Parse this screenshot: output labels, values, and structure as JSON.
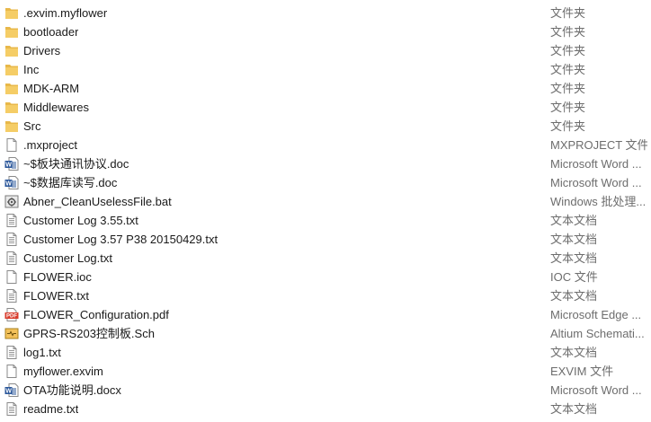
{
  "files": [
    {
      "name": ".exvim.myflower",
      "type": "文件夹",
      "icon": "folder-icon"
    },
    {
      "name": "bootloader",
      "type": "文件夹",
      "icon": "folder-icon"
    },
    {
      "name": "Drivers",
      "type": "文件夹",
      "icon": "folder-icon"
    },
    {
      "name": "Inc",
      "type": "文件夹",
      "icon": "folder-icon"
    },
    {
      "name": "MDK-ARM",
      "type": "文件夹",
      "icon": "folder-icon"
    },
    {
      "name": "Middlewares",
      "type": "文件夹",
      "icon": "folder-icon"
    },
    {
      "name": "Src",
      "type": "文件夹",
      "icon": "folder-icon"
    },
    {
      "name": ".mxproject",
      "type": "MXPROJECT 文件",
      "icon": "blank-file-icon"
    },
    {
      "name": "~$板块通讯协议.doc",
      "type": "Microsoft Word ...",
      "icon": "word-doc-icon"
    },
    {
      "name": "~$数据库读写.doc",
      "type": "Microsoft Word ...",
      "icon": "word-doc-icon"
    },
    {
      "name": "Abner_CleanUselessFile.bat",
      "type": "Windows 批处理...",
      "icon": "batch-file-icon"
    },
    {
      "name": "Customer Log 3.55.txt",
      "type": "文本文档",
      "icon": "text-file-icon"
    },
    {
      "name": "Customer Log 3.57 P38 20150429.txt",
      "type": "文本文档",
      "icon": "text-file-icon"
    },
    {
      "name": "Customer Log.txt",
      "type": "文本文档",
      "icon": "text-file-icon"
    },
    {
      "name": "FLOWER.ioc",
      "type": "IOC 文件",
      "icon": "blank-file-icon"
    },
    {
      "name": "FLOWER.txt",
      "type": "文本文档",
      "icon": "text-file-icon"
    },
    {
      "name": "FLOWER_Configuration.pdf",
      "type": "Microsoft Edge ...",
      "icon": "pdf-file-icon"
    },
    {
      "name": "GPRS-RS203控制板.Sch",
      "type": "Altium Schemati...",
      "icon": "schematic-file-icon"
    },
    {
      "name": "log1.txt",
      "type": "文本文档",
      "icon": "text-file-icon"
    },
    {
      "name": "myflower.exvim",
      "type": "EXVIM 文件",
      "icon": "blank-file-icon"
    },
    {
      "name": "OTA功能说明.docx",
      "type": "Microsoft Word ...",
      "icon": "word-doc-icon"
    },
    {
      "name": "readme.txt",
      "type": "文本文档",
      "icon": "text-file-icon"
    }
  ],
  "colors": {
    "folder": "#e8b84a",
    "word": "#2b579a",
    "pdf": "#d83b2b",
    "type_text": "#6d6d6d"
  }
}
